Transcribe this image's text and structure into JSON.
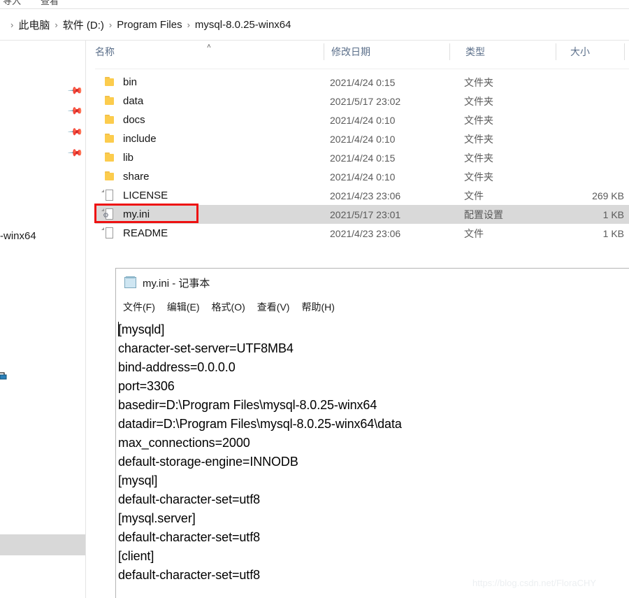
{
  "ribbon": {
    "cut_off_glyph_left": "导入",
    "cut_off_glyph_right": "查看"
  },
  "addressbar": {
    "separator": "›",
    "crumbs": [
      "此电脑",
      "软件 (D:)",
      "Program Files",
      "mysql-8.0.25-winx64"
    ]
  },
  "navpane": {
    "pin_icon": "📌",
    "pin_count": 4,
    "truncated_label": "-winx64"
  },
  "filelist": {
    "sort_indicator": "˄",
    "columns": [
      {
        "key": "name",
        "label": "名称"
      },
      {
        "key": "date",
        "label": "修改日期"
      },
      {
        "key": "type",
        "label": "类型"
      },
      {
        "key": "size",
        "label": "大小"
      }
    ],
    "rows": [
      {
        "name": "bin",
        "date": "2021/4/24 0:15",
        "type": "文件夹",
        "size": "",
        "icon": "folder-icon",
        "selected": false
      },
      {
        "name": "data",
        "date": "2021/5/17 23:02",
        "type": "文件夹",
        "size": "",
        "icon": "folder-icon",
        "selected": false
      },
      {
        "name": "docs",
        "date": "2021/4/24 0:10",
        "type": "文件夹",
        "size": "",
        "icon": "folder-icon",
        "selected": false
      },
      {
        "name": "include",
        "date": "2021/4/24 0:10",
        "type": "文件夹",
        "size": "",
        "icon": "folder-icon",
        "selected": false
      },
      {
        "name": "lib",
        "date": "2021/4/24 0:15",
        "type": "文件夹",
        "size": "",
        "icon": "folder-icon",
        "selected": false
      },
      {
        "name": "share",
        "date": "2021/4/24 0:10",
        "type": "文件夹",
        "size": "",
        "icon": "folder-icon",
        "selected": false
      },
      {
        "name": "LICENSE",
        "date": "2021/4/23 23:06",
        "type": "文件",
        "size": "269 KB",
        "icon": "file-icon",
        "selected": false
      },
      {
        "name": "my.ini",
        "date": "2021/5/17 23:01",
        "type": "配置设置",
        "size": "1 KB",
        "icon": "ini-file-icon",
        "selected": true
      },
      {
        "name": "README",
        "date": "2021/4/23 23:06",
        "type": "文件",
        "size": "1 KB",
        "icon": "file-icon",
        "selected": false
      }
    ],
    "highlight_color": "#ee1111",
    "selection_color": "#d9d9d9"
  },
  "notepad": {
    "title": "my.ini - 记事本",
    "app_icon": "notepad-icon",
    "menu": [
      "文件(F)",
      "编辑(E)",
      "格式(O)",
      "查看(V)",
      "帮助(H)"
    ],
    "content_lines": [
      "[mysqld]",
      "character-set-server=UTF8MB4",
      "bind-address=0.0.0.0",
      "port=3306",
      "basedir=D:\\Program Files\\mysql-8.0.25-winx64",
      "datadir=D:\\Program Files\\mysql-8.0.25-winx64\\data",
      "max_connections=2000",
      "default-storage-engine=INNODB",
      "[mysql]",
      "default-character-set=utf8",
      "[mysql.server]",
      "default-character-set=utf8",
      "[client]",
      "default-character-set=utf8"
    ]
  },
  "watermark": {
    "text": "https://blog.csdn.net/FloraCHY"
  }
}
